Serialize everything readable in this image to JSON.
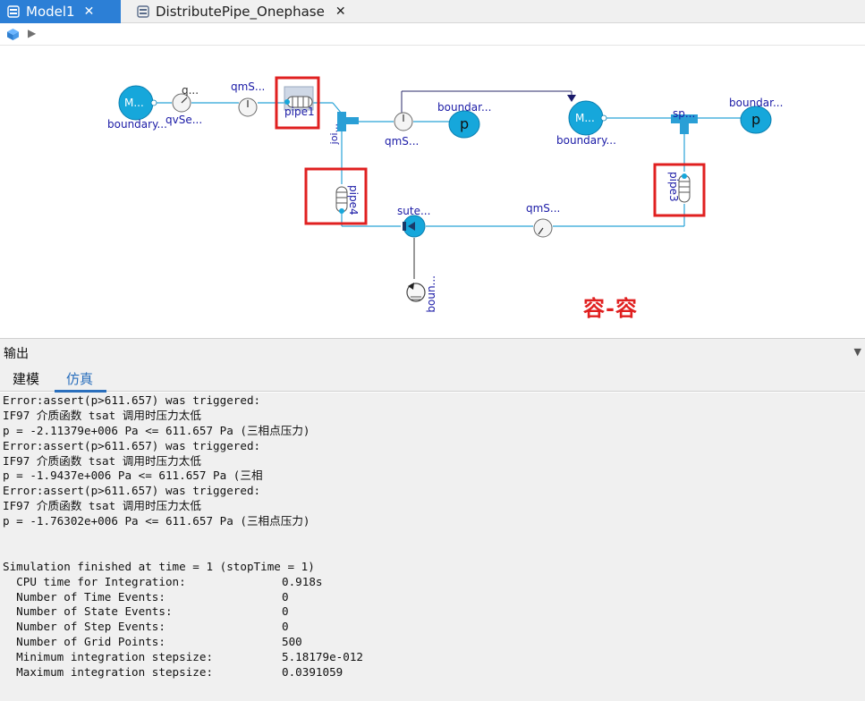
{
  "tabs": [
    {
      "label": "Model1",
      "close": "✕",
      "active": true
    },
    {
      "label": "DistributePipe_Onephase",
      "close": "✕",
      "active": false
    }
  ],
  "diagram": {
    "watermark": "容-容",
    "labels": {
      "src_mass_glyph": "M...",
      "src_boundary": "boundary...",
      "qv_top": "q...",
      "qv_bottom": "qvSe...",
      "qm1_top": "qmS...",
      "pipe1": "pipe1",
      "joint": "joi...",
      "qm2_bottom": "qmS...",
      "bnd_p1_top": "boundar...",
      "p_glyph": "p",
      "mid_mass_glyph": "M...",
      "mid_boundary": "boundary...",
      "split": "sp...",
      "bnd_p2_top": "boundar...",
      "pipe4": "pipe4",
      "pipe3": "pipe3",
      "sute": "sute...",
      "qm3_top": "qmS...",
      "boun": "boun..."
    }
  },
  "output": {
    "title": "输出",
    "collapse_glyph": "▼",
    "subtabs": [
      "建模",
      "仿真"
    ],
    "active_subtab": 1,
    "lines": [
      "Error:assert(p>611.657) was triggered:",
      "IF97 介质函数 tsat 调用时压力太低",
      "p = -2.11379e+006 Pa <= 611.657 Pa (三相点压力)",
      "Error:assert(p>611.657) was triggered:",
      "IF97 介质函数 tsat 调用时压力太低",
      "p = -1.9437e+006 Pa <= 611.657 Pa (三相",
      "Error:assert(p>611.657) was triggered:",
      "IF97 介质函数 tsat 调用时压力太低",
      "p = -1.76302e+006 Pa <= 611.657 Pa (三相点压力)",
      "",
      "",
      "Simulation finished at time = 1 (stopTime = 1)"
    ],
    "stats": [
      {
        "label": "  CPU time for Integration:",
        "value": "0.918s"
      },
      {
        "label": "  Number of Time Events:",
        "value": "0"
      },
      {
        "label": "  Number of State Events:",
        "value": "0"
      },
      {
        "label": "  Number of Step Events:",
        "value": "0"
      },
      {
        "label": "  Number of Grid Points:",
        "value": "500"
      },
      {
        "label": "  Minimum integration stepsize:",
        "value": "5.18179e-012"
      },
      {
        "label": "  Maximum integration stepsize:",
        "value": "0.0391059"
      }
    ]
  }
}
